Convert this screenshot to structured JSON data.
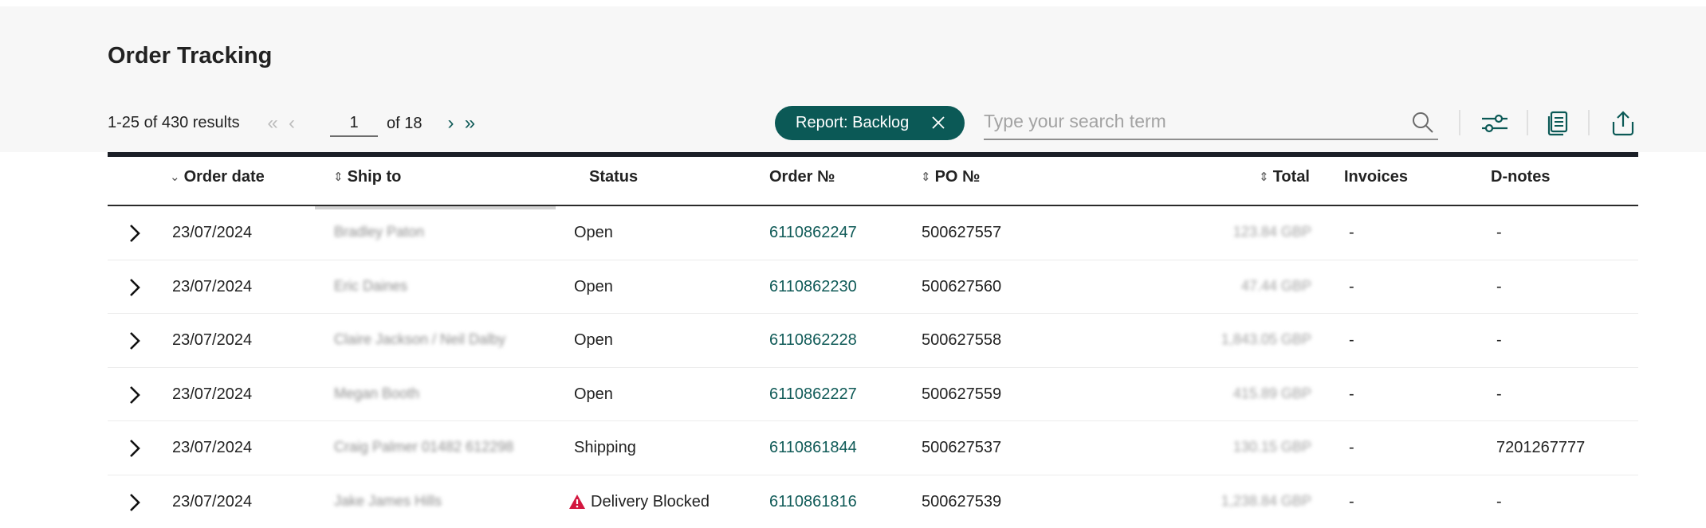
{
  "page": {
    "title": "Order Tracking"
  },
  "pagination": {
    "results_text": "1-25 of 430 results",
    "current_page": "1",
    "of_text": "of 18",
    "first_icon": "chevron-double-left-icon",
    "prev_icon": "chevron-left-icon",
    "next_icon": "chevron-right-icon",
    "last_icon": "chevron-double-right-icon"
  },
  "filters": {
    "report_chip_label": "Report: Backlog",
    "search_placeholder": "Type your search term",
    "search_value": ""
  },
  "toolbar": {
    "filter_icon": "sliders-icon",
    "documents_icon": "documents-icon",
    "export_icon": "share-export-icon"
  },
  "colors": {
    "accent": "#0b5956",
    "link": "#0f5a57",
    "warning": "#d3173f",
    "panel_bg": "#f7f7f7",
    "table_bar": "#1b1f27"
  },
  "table": {
    "columns": [
      {
        "label": "Order date",
        "sort": "descending"
      },
      {
        "label": "Ship to",
        "sort": "sortable"
      },
      {
        "label": "Status",
        "sort": "none"
      },
      {
        "label": "Order №",
        "sort": "none"
      },
      {
        "label": "PO №",
        "sort": "sortable"
      },
      {
        "label": "Total",
        "sort": "sortable"
      },
      {
        "label": "Invoices",
        "sort": "none"
      },
      {
        "label": "D-notes",
        "sort": "none"
      }
    ],
    "rows": [
      {
        "date": "23/07/2024",
        "ship_to": "Bradley Paton",
        "status": "Open",
        "order_no": "6110862247",
        "po_no": "500627557",
        "total": "123.84 GBP",
        "invoices": "-",
        "dnotes": "-",
        "warning": false
      },
      {
        "date": "23/07/2024",
        "ship_to": "Eric Daines",
        "status": "Open",
        "order_no": "6110862230",
        "po_no": "500627560",
        "total": "47.44 GBP",
        "invoices": "-",
        "dnotes": "-",
        "warning": false
      },
      {
        "date": "23/07/2024",
        "ship_to": "Claire Jackson / Neil Dalby",
        "status": "Open",
        "order_no": "6110862228",
        "po_no": "500627558",
        "total": "1,843.05 GBP",
        "invoices": "-",
        "dnotes": "-",
        "warning": false
      },
      {
        "date": "23/07/2024",
        "ship_to": "Megan Booth",
        "status": "Open",
        "order_no": "6110862227",
        "po_no": "500627559",
        "total": "415.89 GBP",
        "invoices": "-",
        "dnotes": "-",
        "warning": false
      },
      {
        "date": "23/07/2024",
        "ship_to": "Craig Palmer 01482 612298",
        "status": "Shipping",
        "order_no": "6110861844",
        "po_no": "500627537",
        "total": "130.15 GBP",
        "invoices": "-",
        "dnotes": "7201267777",
        "warning": false
      },
      {
        "date": "23/07/2024",
        "ship_to": "Jake James Hills",
        "status": "Delivery Blocked",
        "order_no": "6110861816",
        "po_no": "500627539",
        "total": "1,238.84 GBP",
        "invoices": "-",
        "dnotes": "-",
        "warning": true
      }
    ]
  }
}
